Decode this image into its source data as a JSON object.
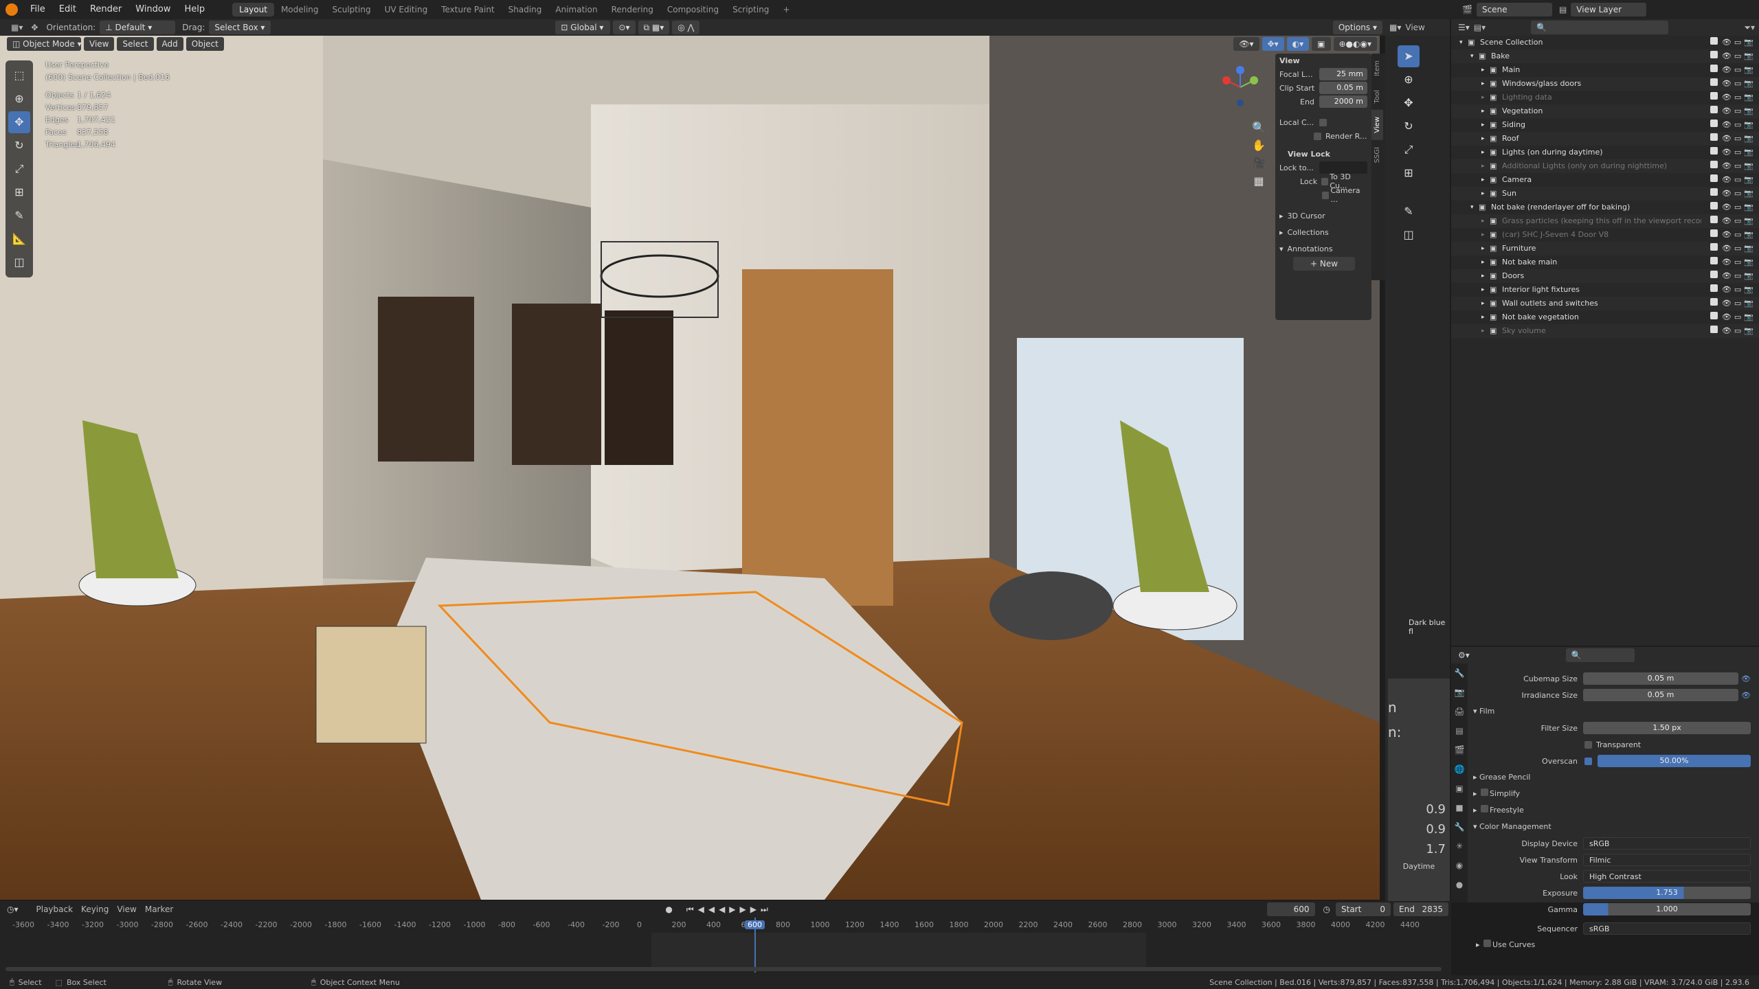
{
  "menu": [
    "File",
    "Edit",
    "Render",
    "Window",
    "Help"
  ],
  "workspaces": [
    "Layout",
    "Modeling",
    "Sculpting",
    "UV Editing",
    "Texture Paint",
    "Shading",
    "Animation",
    "Rendering",
    "Compositing",
    "Scripting",
    "+"
  ],
  "active_workspace": "Layout",
  "toolbar": {
    "orientation_label": "Orientation:",
    "orientation_value": "Default",
    "drag_label": "Drag:",
    "drag_value": "Select Box",
    "transform_value": "Global",
    "options_label": "Options"
  },
  "viewport_header": {
    "mode": "Object Mode",
    "menus": [
      "View",
      "Select",
      "Add",
      "Object"
    ]
  },
  "overlay": {
    "view_name": "User Perspective",
    "collection": "(600) Scene Collection | Bed.016",
    "stats": [
      {
        "k": "Objects",
        "v": "1 / 1,624"
      },
      {
        "k": "Vertices",
        "v": "879,857"
      },
      {
        "k": "Edges",
        "v": "1,707,421"
      },
      {
        "k": "Faces",
        "v": "837,558"
      },
      {
        "k": "Triangles",
        "v": "1,706,494"
      }
    ]
  },
  "npanel": {
    "view_title": "View",
    "focal_label": "Focal L...",
    "focal_value": "25 mm",
    "clip_start_label": "Clip Start",
    "clip_start_value": "0.05 m",
    "clip_end_label": "End",
    "clip_end_value": "2000 m",
    "local_camera_label": "Local C...",
    "render_region_label": "Render R...",
    "view_lock_title": "View Lock",
    "lock_to_label": "Lock to...",
    "lock_label": "Lock",
    "lock_opt1": "To 3D Cu...",
    "lock_opt2": "Camera ...",
    "sections": [
      "3D Cursor",
      "Collections",
      "Annotations"
    ],
    "new_label": "New",
    "tabs": [
      "Item",
      "Tool",
      "View",
      "SSGI"
    ]
  },
  "right_editor": {
    "view_label": "View",
    "dark_blue": "Dark blue fl",
    "daytime": "Daytime",
    "values": [
      "0.9",
      "0.9",
      "1.7"
    ],
    "letters": [
      "n",
      "n:"
    ]
  },
  "scene": {
    "scene_name": "Scene",
    "view_layer": "View Layer"
  },
  "outliner": [
    {
      "label": "Scene Collection",
      "indent": 0,
      "dim": false
    },
    {
      "label": "Bake",
      "indent": 1,
      "dim": false
    },
    {
      "label": "Main",
      "indent": 2,
      "dim": false
    },
    {
      "label": "Windows/glass doors",
      "indent": 2,
      "dim": false
    },
    {
      "label": "Lighting data",
      "indent": 2,
      "dim": true
    },
    {
      "label": "Vegetation",
      "indent": 2,
      "dim": false
    },
    {
      "label": "Siding",
      "indent": 2,
      "dim": false
    },
    {
      "label": "Roof",
      "indent": 2,
      "dim": false
    },
    {
      "label": "Lights (on during daytime)",
      "indent": 2,
      "dim": false
    },
    {
      "label": "Additional Lights (only on during nighttime)",
      "indent": 2,
      "dim": true
    },
    {
      "label": "Camera",
      "indent": 2,
      "dim": false
    },
    {
      "label": "Sun",
      "indent": 2,
      "dim": false
    },
    {
      "label": "Not bake (renderlayer off for baking)",
      "indent": 1,
      "dim": false
    },
    {
      "label": "Grass particles (keeping this off in the viewport recomm",
      "indent": 2,
      "dim": true
    },
    {
      "label": "(car) SHC J-Seven 4 Door V8",
      "indent": 2,
      "dim": true
    },
    {
      "label": "Furniture",
      "indent": 2,
      "dim": false
    },
    {
      "label": "Not bake main",
      "indent": 2,
      "dim": false
    },
    {
      "label": "Doors",
      "indent": 2,
      "dim": false
    },
    {
      "label": "Interior light fixtures",
      "indent": 2,
      "dim": false
    },
    {
      "label": "Wall outlets and switches",
      "indent": 2,
      "dim": false
    },
    {
      "label": "Not bake vegetation",
      "indent": 2,
      "dim": false
    },
    {
      "label": "Sky volume",
      "indent": 2,
      "dim": true
    }
  ],
  "properties": {
    "cubemap_label": "Cubemap Size",
    "cubemap_value": "0.05 m",
    "irradiance_label": "Irradiance Size",
    "irradiance_value": "0.05 m",
    "film_title": "Film",
    "filter_label": "Filter Size",
    "filter_value": "1.50 px",
    "transparent_label": "Transparent",
    "overscan_label": "Overscan",
    "overscan_value": "50.00%",
    "grease_pencil": "Grease Pencil",
    "simplify": "Simplify",
    "freestyle": "Freestyle",
    "color_mgmt": "Color Management",
    "display_label": "Display Device",
    "display_value": "sRGB",
    "view_label": "View Transform",
    "view_value": "Filmic",
    "look_label": "Look",
    "look_value": "High Contrast",
    "exposure_label": "Exposure",
    "exposure_value": "1.753",
    "gamma_label": "Gamma",
    "gamma_value": "1.000",
    "sequencer_label": "Sequencer",
    "sequencer_value": "sRGB",
    "use_curves": "Use Curves"
  },
  "timeline": {
    "menus": [
      "Playback",
      "Keying",
      "View",
      "Marker"
    ],
    "current_frame": "600",
    "start_label": "Start",
    "start_value": "0",
    "end_label": "End",
    "end_value": "2835",
    "ticks": [
      "-3600",
      "-3400",
      "-3200",
      "-3000",
      "-2800",
      "-2600",
      "-2400",
      "-2200",
      "-2000",
      "-1800",
      "-1600",
      "-1400",
      "-1200",
      "-1000",
      "-800",
      "-600",
      "-400",
      "-200",
      "0",
      "200",
      "400",
      "600",
      "800",
      "1000",
      "1200",
      "1400",
      "1600",
      "1800",
      "2000",
      "2200",
      "2400",
      "2600",
      "2800",
      "3000",
      "3200",
      "3400",
      "3600",
      "3800",
      "4000",
      "4200",
      "4400"
    ]
  },
  "status": {
    "select": "Select",
    "box_select": "Box Select",
    "rotate": "Rotate View",
    "context": "Object Context Menu",
    "info": "Scene Collection | Bed.016 | Verts:879,857 | Faces:837,558 | Tris:1,706,494 | Objects:1/1,624 | Memory: 2.88 GiB | VRAM: 3.7/24.0 GiB | 2.93.6"
  }
}
